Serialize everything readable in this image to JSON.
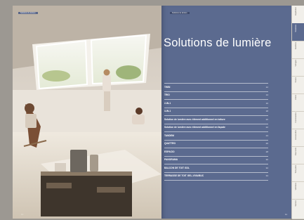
{
  "left_page": {
    "tag": "Solutions de lumière",
    "page_number": "10"
  },
  "right_page": {
    "tag": "Solutions de lumière",
    "title": "Solutions de lumière",
    "page_number": "11",
    "toc": [
      {
        "label": "TWIN",
        "page": "12"
      },
      {
        "label": "TRIO",
        "page": "14"
      },
      {
        "label": "2-IN-1",
        "page": "16"
      },
      {
        "label": "3-IN-1",
        "page": "18"
      },
      {
        "label": "Solution de lumière avec élément additionnel en toiture",
        "page": "20"
      },
      {
        "label": "Solution de lumière avec élément additionnel en façade",
        "page": "22"
      },
      {
        "label": "TANDEM",
        "page": "24"
      },
      {
        "label": "QUATTRO",
        "page": "26"
      },
      {
        "label": "ESPACIO",
        "page": "28"
      },
      {
        "label": "PANORAMA",
        "page": "30"
      },
      {
        "label": "BALCON DE TOIT GDL",
        "page": "32"
      },
      {
        "label": "TERRASSE DE TOIT GEL-VIVA/BUC",
        "page": "34"
      }
    ]
  },
  "side_tabs": [
    {
      "label": "Inspiration"
    },
    {
      "label": "Solutions"
    },
    {
      "label": "Fenêtres"
    },
    {
      "label": "Vitrages"
    },
    {
      "label": "Stores"
    },
    {
      "label": "Volets"
    },
    {
      "label": "Commandes"
    },
    {
      "label": "Accessoires"
    },
    {
      "label": "Raccords"
    },
    {
      "label": "Toits plats"
    },
    {
      "label": "Verrières"
    },
    {
      "label": "Service"
    }
  ],
  "colors": {
    "accent_blue": "#5b6a8f",
    "paper": "#f1efea"
  }
}
